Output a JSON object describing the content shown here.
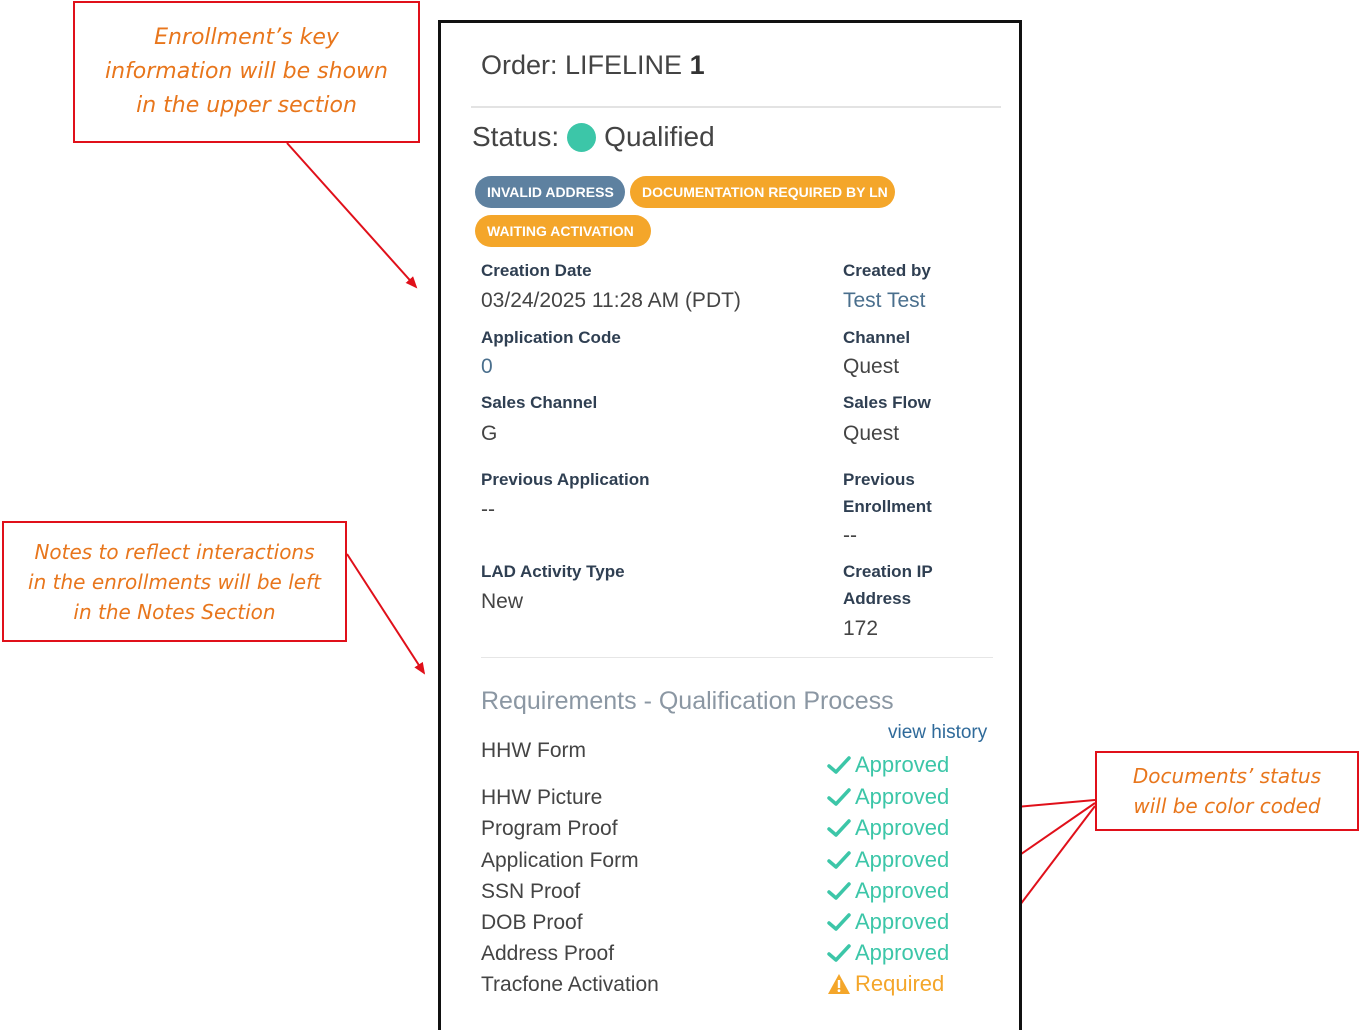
{
  "callouts": {
    "upper": [
      "Enrollment’s key",
      "information will be shown",
      "in the upper section"
    ],
    "notes": [
      "Notes to reflect interactions",
      "in the enrollments will be left",
      "in the Notes Section"
    ],
    "documents": [
      "Documents’ status",
      "will be color coded"
    ]
  },
  "order": {
    "title_prefix": "Order: LIFELINE",
    "title_number": "1",
    "status_label": "Status:",
    "status_value": "Qualified",
    "status_color": "#3cc6a8"
  },
  "badges": [
    {
      "label": "INVALID ADDRESS",
      "color": "#5e81a0"
    },
    {
      "label": "DOCUMENTATION REQUIRED BY LN",
      "color": "#f4a62a"
    },
    {
      "label": "WAITING ACTIVATION",
      "color": "#f4a62a"
    }
  ],
  "fields": {
    "creation_date": {
      "label": "Creation Date",
      "value": "03/24/2025 11:28 AM (PDT)"
    },
    "created_by": {
      "label": "Created by",
      "value": "Test Test"
    },
    "application_code": {
      "label": "Application Code",
      "value": "0"
    },
    "channel": {
      "label": "Channel",
      "value": "Quest"
    },
    "sales_channel": {
      "label": "Sales Channel",
      "value": "G"
    },
    "sales_flow": {
      "label": "Sales Flow",
      "value": "Quest"
    },
    "previous_application": {
      "label": "Previous Application",
      "value": "--"
    },
    "previous_enrollment": {
      "label_line1": "Previous",
      "label_line2": "Enrollment",
      "value": "--"
    },
    "lad_activity_type": {
      "label": "LAD Activity Type",
      "value": "New"
    },
    "creation_ip": {
      "label_line1": "Creation IP",
      "label_line2": "Address",
      "value": "172"
    }
  },
  "requirements": {
    "title": "Requirements - Qualification Process",
    "view_history": "view history",
    "items": [
      {
        "name": "HHW Form",
        "status": "Approved",
        "state": "approved"
      },
      {
        "name": "HHW Picture",
        "status": "Approved",
        "state": "approved"
      },
      {
        "name": "Program Proof",
        "status": "Approved",
        "state": "approved"
      },
      {
        "name": "Application Form",
        "status": "Approved",
        "state": "approved"
      },
      {
        "name": "SSN Proof",
        "status": "Approved",
        "state": "approved"
      },
      {
        "name": "DOB Proof",
        "status": "Approved",
        "state": "approved"
      },
      {
        "name": "Address Proof",
        "status": "Approved",
        "state": "approved"
      },
      {
        "name": "Tracfone Activation",
        "status": "Required",
        "state": "required"
      }
    ],
    "approved_color": "#3cc6a8",
    "required_color": "#f4a62a"
  },
  "icons": {
    "approved": "check-icon",
    "required": "warning-icon"
  }
}
